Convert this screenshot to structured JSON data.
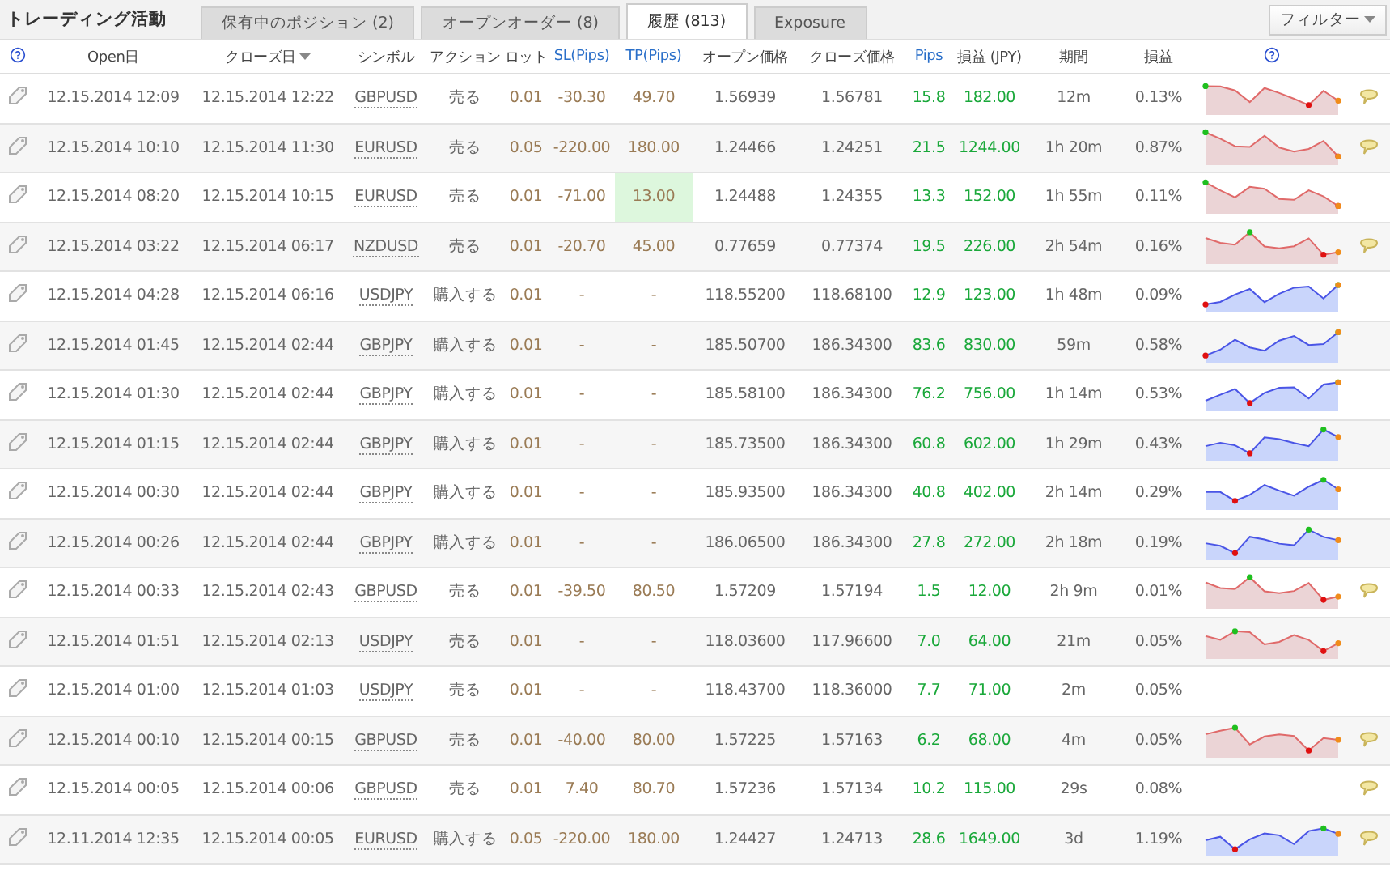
{
  "title": "トレーディング活動",
  "tabs": [
    {
      "label": "保有中のポジション (2)",
      "selected": false
    },
    {
      "label": "オープンオーダー (8)",
      "selected": false
    },
    {
      "label": "履歴 (813)",
      "selected": true
    },
    {
      "label": "Exposure",
      "selected": false
    }
  ],
  "filter_button": "フィルター",
  "columns": [
    {
      "kind": "help"
    },
    {
      "kind": "text",
      "label": "Open日",
      "accent": false,
      "sorted": false
    },
    {
      "kind": "text",
      "label": "クローズ日",
      "accent": false,
      "sorted": true
    },
    {
      "kind": "text",
      "label": "シンボル",
      "accent": false,
      "sorted": false
    },
    {
      "kind": "text",
      "label": "アクション",
      "accent": false,
      "sorted": false
    },
    {
      "kind": "text",
      "label": "ロット",
      "accent": false,
      "sorted": false
    },
    {
      "kind": "text",
      "label": "SL(Pips)",
      "accent": true,
      "sorted": false
    },
    {
      "kind": "text",
      "label": "TP(Pips)",
      "accent": true,
      "sorted": false
    },
    {
      "kind": "text",
      "label": "オープン価格",
      "accent": false,
      "sorted": false
    },
    {
      "kind": "text",
      "label": "クローズ価格",
      "accent": false,
      "sorted": false
    },
    {
      "kind": "text",
      "label": "Pips",
      "accent": true,
      "sorted": false
    },
    {
      "kind": "text",
      "label": "損益 (JPY)",
      "accent": false,
      "sorted": false
    },
    {
      "kind": "text",
      "label": "期間",
      "accent": false,
      "sorted": false
    },
    {
      "kind": "text",
      "label": "損益",
      "accent": false,
      "sorted": false
    },
    {
      "kind": "help"
    },
    {
      "kind": "blank"
    }
  ],
  "rows": [
    {
      "open": "12.15.2014 12:09",
      "close": "12.15.2014 12:22",
      "symbol": "GBPUSD",
      "action": "売る",
      "lot": "0.01",
      "sl": "-30.30",
      "tp": "49.70",
      "tp_hit": false,
      "open_price": "1.56939",
      "close_price": "1.56781",
      "pips": "15.8",
      "pl": "182.00",
      "period": "12m",
      "pl_pct": "0.13%",
      "chart": {
        "kind": "sell"
      },
      "comment": true
    },
    {
      "open": "12.15.2014 10:10",
      "close": "12.15.2014 11:30",
      "symbol": "EURUSD",
      "action": "売る",
      "lot": "0.05",
      "sl": "-220.00",
      "tp": "180.00",
      "tp_hit": false,
      "open_price": "1.24466",
      "close_price": "1.24251",
      "pips": "21.5",
      "pl": "1244.00",
      "period": "1h 20m",
      "pl_pct": "0.87%",
      "chart": {
        "kind": "sell"
      },
      "comment": true
    },
    {
      "open": "12.15.2014 08:20",
      "close": "12.15.2014 10:15",
      "symbol": "EURUSD",
      "action": "売る",
      "lot": "0.01",
      "sl": "-71.00",
      "tp": "13.00",
      "tp_hit": true,
      "open_price": "1.24488",
      "close_price": "1.24355",
      "pips": "13.3",
      "pl": "152.00",
      "period": "1h 55m",
      "pl_pct": "0.11%",
      "chart": {
        "kind": "sell"
      },
      "comment": false
    },
    {
      "open": "12.15.2014 03:22",
      "close": "12.15.2014 06:17",
      "symbol": "NZDUSD",
      "action": "売る",
      "lot": "0.01",
      "sl": "-20.70",
      "tp": "45.00",
      "tp_hit": false,
      "open_price": "0.77659",
      "close_price": "0.77374",
      "pips": "19.5",
      "pl": "226.00",
      "period": "2h 54m",
      "pl_pct": "0.16%",
      "chart": {
        "kind": "sell"
      },
      "comment": true
    },
    {
      "open": "12.15.2014 04:28",
      "close": "12.15.2014 06:16",
      "symbol": "USDJPY",
      "action": "購入する",
      "lot": "0.01",
      "sl": "-",
      "tp": "-",
      "tp_hit": false,
      "open_price": "118.55200",
      "close_price": "118.68100",
      "pips": "12.9",
      "pl": "123.00",
      "period": "1h 48m",
      "pl_pct": "0.09%",
      "chart": {
        "kind": "buy"
      },
      "comment": false
    },
    {
      "open": "12.15.2014 01:45",
      "close": "12.15.2014 02:44",
      "symbol": "GBPJPY",
      "action": "購入する",
      "lot": "0.01",
      "sl": "-",
      "tp": "-",
      "tp_hit": false,
      "open_price": "185.50700",
      "close_price": "186.34300",
      "pips": "83.6",
      "pl": "830.00",
      "period": "59m",
      "pl_pct": "0.58%",
      "chart": {
        "kind": "buy"
      },
      "comment": false
    },
    {
      "open": "12.15.2014 01:30",
      "close": "12.15.2014 02:44",
      "symbol": "GBPJPY",
      "action": "購入する",
      "lot": "0.01",
      "sl": "-",
      "tp": "-",
      "tp_hit": false,
      "open_price": "185.58100",
      "close_price": "186.34300",
      "pips": "76.2",
      "pl": "756.00",
      "period": "1h 14m",
      "pl_pct": "0.53%",
      "chart": {
        "kind": "buy"
      },
      "comment": false
    },
    {
      "open": "12.15.2014 01:15",
      "close": "12.15.2014 02:44",
      "symbol": "GBPJPY",
      "action": "購入する",
      "lot": "0.01",
      "sl": "-",
      "tp": "-",
      "tp_hit": false,
      "open_price": "185.73500",
      "close_price": "186.34300",
      "pips": "60.8",
      "pl": "602.00",
      "period": "1h 29m",
      "pl_pct": "0.43%",
      "chart": {
        "kind": "buy"
      },
      "comment": false
    },
    {
      "open": "12.15.2014 00:30",
      "close": "12.15.2014 02:44",
      "symbol": "GBPJPY",
      "action": "購入する",
      "lot": "0.01",
      "sl": "-",
      "tp": "-",
      "tp_hit": false,
      "open_price": "185.93500",
      "close_price": "186.34300",
      "pips": "40.8",
      "pl": "402.00",
      "period": "2h 14m",
      "pl_pct": "0.29%",
      "chart": {
        "kind": "buy"
      },
      "comment": false
    },
    {
      "open": "12.15.2014 00:26",
      "close": "12.15.2014 02:44",
      "symbol": "GBPJPY",
      "action": "購入する",
      "lot": "0.01",
      "sl": "-",
      "tp": "-",
      "tp_hit": false,
      "open_price": "186.06500",
      "close_price": "186.34300",
      "pips": "27.8",
      "pl": "272.00",
      "period": "2h 18m",
      "pl_pct": "0.19%",
      "chart": {
        "kind": "buy"
      },
      "comment": false
    },
    {
      "open": "12.15.2014 00:33",
      "close": "12.15.2014 02:43",
      "symbol": "GBPUSD",
      "action": "売る",
      "lot": "0.01",
      "sl": "-39.50",
      "tp": "80.50",
      "tp_hit": false,
      "open_price": "1.57209",
      "close_price": "1.57194",
      "pips": "1.5",
      "pl": "12.00",
      "period": "2h 9m",
      "pl_pct": "0.01%",
      "chart": {
        "kind": "sell"
      },
      "comment": true
    },
    {
      "open": "12.15.2014 01:51",
      "close": "12.15.2014 02:13",
      "symbol": "USDJPY",
      "action": "売る",
      "lot": "0.01",
      "sl": "-",
      "tp": "-",
      "tp_hit": false,
      "open_price": "118.03600",
      "close_price": "117.96600",
      "pips": "7.0",
      "pl": "64.00",
      "period": "21m",
      "pl_pct": "0.05%",
      "chart": {
        "kind": "sell"
      },
      "comment": false
    },
    {
      "open": "12.15.2014 01:00",
      "close": "12.15.2014 01:03",
      "symbol": "USDJPY",
      "action": "売る",
      "lot": "0.01",
      "sl": "-",
      "tp": "-",
      "tp_hit": false,
      "open_price": "118.43700",
      "close_price": "118.36000",
      "pips": "7.7",
      "pl": "71.00",
      "period": "2m",
      "pl_pct": "0.05%",
      "comment": false
    },
    {
      "open": "12.15.2014 00:10",
      "close": "12.15.2014 00:15",
      "symbol": "GBPUSD",
      "action": "売る",
      "lot": "0.01",
      "sl": "-40.00",
      "tp": "80.00",
      "tp_hit": false,
      "open_price": "1.57225",
      "close_price": "1.57163",
      "pips": "6.2",
      "pl": "68.00",
      "period": "4m",
      "pl_pct": "0.05%",
      "chart": {
        "kind": "sell"
      },
      "comment": true
    },
    {
      "open": "12.15.2014 00:05",
      "close": "12.15.2014 00:06",
      "symbol": "GBPUSD",
      "action": "売る",
      "lot": "0.01",
      "sl": "7.40",
      "tp": "80.70",
      "tp_hit": false,
      "open_price": "1.57236",
      "close_price": "1.57134",
      "pips": "10.2",
      "pl": "115.00",
      "period": "29s",
      "pl_pct": "0.08%",
      "comment": true
    },
    {
      "open": "12.11.2014 12:35",
      "close": "12.15.2014 00:05",
      "symbol": "EURUSD",
      "action": "購入する",
      "lot": "0.05",
      "sl": "-220.00",
      "tp": "180.00",
      "tp_hit": false,
      "open_price": "1.24427",
      "close_price": "1.24713",
      "pips": "28.6",
      "pl": "1649.00",
      "period": "3d",
      "pl_pct": "1.19%",
      "chart": {
        "kind": "buy"
      },
      "comment": true
    }
  ]
}
